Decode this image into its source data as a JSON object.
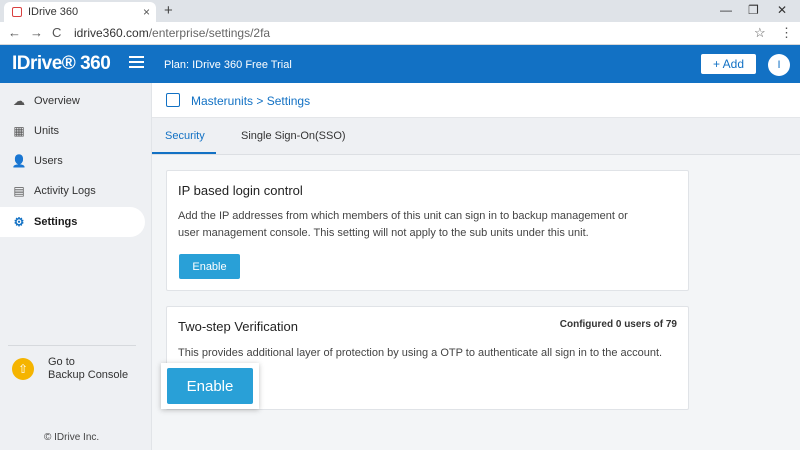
{
  "browser": {
    "tab_title": "IDrive 360",
    "tab_close": "×",
    "new_tab": "+",
    "minimize": "—",
    "restore": "❐",
    "close": "✕",
    "back": "←",
    "forward": "→",
    "reload": "C",
    "url_host": "idrive360.com",
    "url_path": "/enterprise/settings/2fa",
    "star": "☆",
    "menu": "⋮"
  },
  "header": {
    "logo": "IDrive® 360",
    "plan": "Plan: IDrive 360 Free Trial",
    "add_label": "+ Add",
    "avatar_initial": "I"
  },
  "sidebar": {
    "items": [
      {
        "label": "Overview",
        "icon": "cloud-icon"
      },
      {
        "label": "Units",
        "icon": "grid-icon"
      },
      {
        "label": "Users",
        "icon": "user-icon"
      },
      {
        "label": "Activity Logs",
        "icon": "clipboard-icon"
      },
      {
        "label": "Settings",
        "icon": "gear-icon",
        "active": true
      }
    ],
    "backup_line1": "Go to",
    "backup_line2": "Backup Console",
    "copyright": "© IDrive Inc."
  },
  "breadcrumb": {
    "parent": "Masterunits",
    "separator": ">",
    "current": "Settings"
  },
  "tabs": [
    {
      "label": "Security",
      "active": true
    },
    {
      "label": "Single Sign-On(SSO)"
    }
  ],
  "ip_card": {
    "title": "IP based login control",
    "description": "Add the IP addresses from which members of this unit can sign in to backup management or user management console. This setting will not apply to the sub units under this unit.",
    "button": "Enable"
  },
  "twostep_card": {
    "title": "Two-step Verification",
    "configured": "Configured 0 users of 79",
    "description": "This provides additional layer of protection by using a OTP to authenticate all sign in to the account.",
    "button": "Enable"
  },
  "colors": {
    "brand_blue": "#1271c4",
    "button_blue": "#29a0d7",
    "backup_yellow": "#f5b400"
  }
}
